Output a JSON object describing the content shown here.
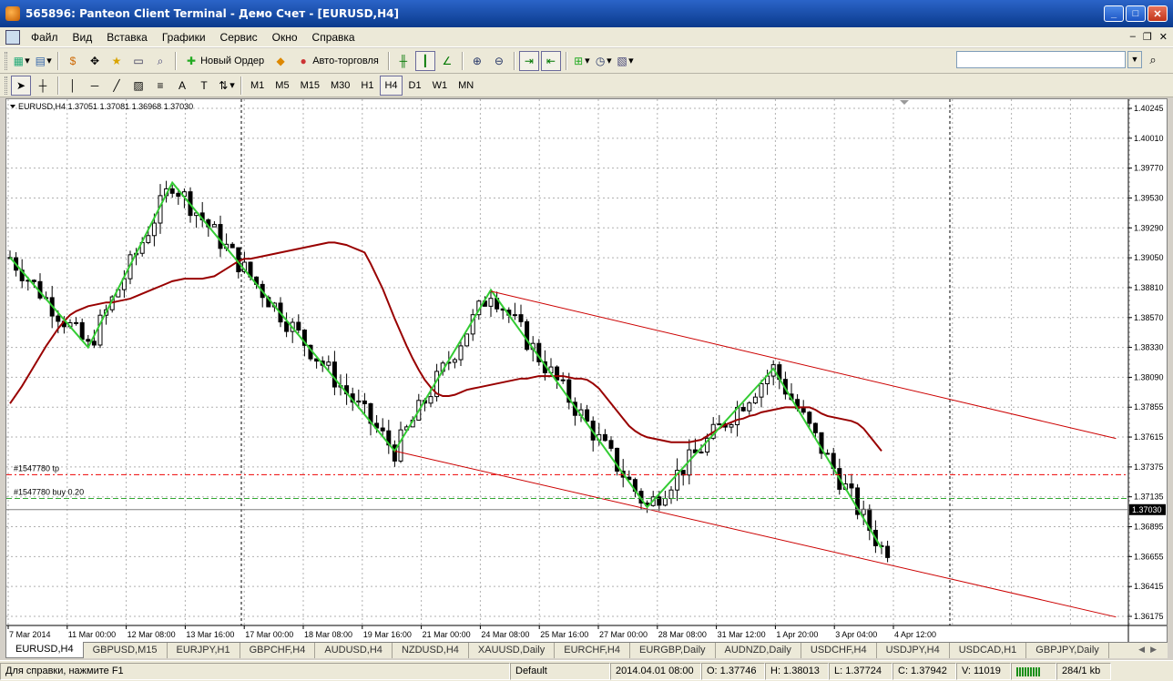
{
  "window": {
    "title": "565896: Panteon Client Terminal - Демо Счет - [EURUSD,H4]"
  },
  "menu": [
    "Файл",
    "Вид",
    "Вставка",
    "Графики",
    "Сервис",
    "Окно",
    "Справка"
  ],
  "toolbar": {
    "new_order": "Новый Ордер",
    "auto_trading": "Авто-торговля"
  },
  "timeframes": [
    "M1",
    "M5",
    "M15",
    "M30",
    "H1",
    "H4",
    "D1",
    "W1",
    "MN"
  ],
  "active_timeframe": "H4",
  "chart": {
    "header": "EURUSD,H4  1.37051 1.37081 1.36968 1.37030",
    "current_price": "1.37030",
    "tp_label": "#1547780 tp",
    "buy_label": "#1547780 buy 0.20",
    "price_labels": [
      "1.40245",
      "1.40010",
      "1.39770",
      "1.39530",
      "1.39290",
      "1.39050",
      "1.38810",
      "1.38570",
      "1.38330",
      "1.38090",
      "1.37855",
      "1.37615",
      "1.37375",
      "1.37135",
      "1.36895",
      "1.36655",
      "1.36415",
      "1.36175"
    ],
    "time_labels": [
      "7 Mar 2014",
      "11 Mar 00:00",
      "12 Mar 08:00",
      "13 Mar 16:00",
      "17 Mar 00:00",
      "18 Mar 08:00",
      "19 Mar 16:00",
      "21 Mar 00:00",
      "24 Mar 08:00",
      "25 Mar 16:00",
      "27 Mar 00:00",
      "28 Mar 08:00",
      "31 Mar 12:00",
      "1 Apr 20:00",
      "3 Apr 04:00",
      "4 Apr 12:00"
    ],
    "colors": {
      "bull": "#ffffff",
      "bear": "#000000",
      "zigzag": "#33cc33",
      "ma": "#990000",
      "channel": "#cc0000",
      "tp_line": "#ee0000",
      "buy_line": "#33aa33"
    }
  },
  "chart_data": {
    "type": "candlestick",
    "symbol": "EURUSD",
    "timeframe": "H4",
    "ylim": [
      1.36175,
      1.40245
    ],
    "ohlc_header": {
      "open": 1.37051,
      "high": 1.37081,
      "low": 1.36968,
      "close": 1.3703
    },
    "candle_count": 147,
    "zigzag_points": [
      [
        0,
        1.3905
      ],
      [
        13,
        1.3833
      ],
      [
        27,
        1.3965
      ],
      [
        64,
        1.375
      ],
      [
        80,
        1.3879
      ],
      [
        106,
        1.3705
      ],
      [
        127,
        1.3816
      ],
      [
        145,
        1.3672
      ]
    ],
    "ma": [
      1.3788,
      1.3795,
      1.3802,
      1.381,
      1.3818,
      1.3826,
      1.3834,
      1.3841,
      1.3848,
      1.3854,
      1.3859,
      1.3862,
      1.3864,
      1.3866,
      1.3867,
      1.3868,
      1.3869,
      1.3869,
      1.387,
      1.3871,
      1.3872,
      1.3874,
      1.3876,
      1.3878,
      1.388,
      1.3882,
      1.3884,
      1.3886,
      1.3887,
      1.3888,
      1.3888,
      1.3888,
      1.3888,
      1.3889,
      1.389,
      1.3893,
      1.3896,
      1.3899,
      1.3902,
      1.3904,
      1.3904,
      1.3905,
      1.3906,
      1.3907,
      1.3908,
      1.3909,
      1.391,
      1.3911,
      1.3912,
      1.3913,
      1.3914,
      1.3915,
      1.3916,
      1.3917,
      1.3917,
      1.3916,
      1.3915,
      1.3913,
      1.3911,
      1.3909,
      1.39,
      1.389,
      1.388,
      1.3868,
      1.3856,
      1.3845,
      1.3834,
      1.3824,
      1.3815,
      1.3807,
      1.3801,
      1.3796,
      1.3794,
      1.3794,
      1.3795,
      1.3797,
      1.3799,
      1.38,
      1.3801,
      1.3802,
      1.3803,
      1.3804,
      1.3805,
      1.3806,
      1.3807,
      1.3808,
      1.3808,
      1.3809,
      1.381,
      1.381,
      1.381,
      1.381,
      1.381,
      1.3809,
      1.3808,
      1.3808,
      1.3807,
      1.3804,
      1.38,
      1.3794,
      1.3788,
      1.3782,
      1.3776,
      1.377,
      1.3766,
      1.3763,
      1.3761,
      1.376,
      1.3759,
      1.3758,
      1.3757,
      1.3757,
      1.3757,
      1.3757,
      1.3758,
      1.3759,
      1.3762,
      1.3765,
      1.3768,
      1.3771,
      1.3773,
      1.3775,
      1.3776,
      1.3778,
      1.3779,
      1.3781,
      1.3782,
      1.3783,
      1.3784,
      1.3785,
      1.3785,
      1.3785,
      1.3785,
      1.3785,
      1.3783,
      1.378,
      1.3778,
      1.3777,
      1.3776,
      1.3775,
      1.3774,
      1.3772,
      1.3768,
      1.3762,
      1.3756,
      1.375
    ],
    "channel_upper": [
      [
        80,
        1.3878
      ],
      [
        127,
        1.3816
      ],
      [
        184,
        1.376
      ]
    ],
    "channel_lower": [
      [
        64,
        1.375
      ],
      [
        106,
        1.3705
      ],
      [
        184,
        1.3617
      ]
    ],
    "tp_level": 1.3731,
    "buy_level": 1.3712
  },
  "tabs": [
    "EURUSD,H4",
    "GBPUSD,M15",
    "EURJPY,H1",
    "GBPCHF,H4",
    "AUDUSD,H4",
    "NZDUSD,H4",
    "XAUUSD,Daily",
    "EURCHF,H4",
    "EURGBP,Daily",
    "AUDNZD,Daily",
    "USDCHF,H4",
    "USDJPY,H4",
    "USDCAD,H1",
    "GBPJPY,Daily"
  ],
  "status": {
    "help": "Для справки, нажмите F1",
    "profile": "Default",
    "datetime": "2014.04.01 08:00",
    "open": "O: 1.37746",
    "high": "H: 1.38013",
    "low": "L: 1.37724",
    "close": "C: 1.37942",
    "volume": "V: 11019",
    "traffic": "284/1 kb"
  }
}
